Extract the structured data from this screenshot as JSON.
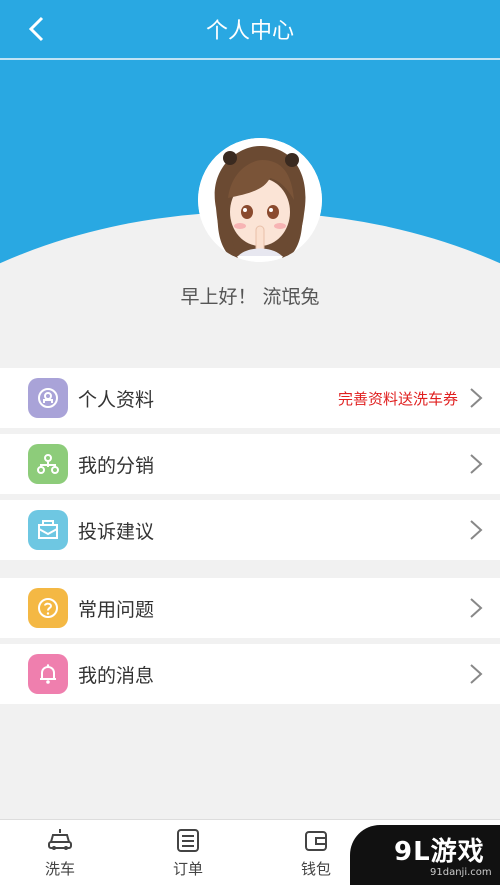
{
  "header": {
    "title": "个人中心"
  },
  "profile": {
    "greeting": "早上好！ 流氓兔"
  },
  "menu": {
    "group1": [
      {
        "label": "个人资料",
        "promo": "完善资料送洗车券",
        "icon": "user-icon",
        "color": "#a9a3d8"
      },
      {
        "label": "我的分销",
        "icon": "share-tree-icon",
        "color": "#8dcc7a"
      },
      {
        "label": "投诉建议",
        "icon": "envelope-icon",
        "color": "#6ec7e2"
      }
    ],
    "group2": [
      {
        "label": "常用问题",
        "icon": "question-icon",
        "color": "#f4b844"
      },
      {
        "label": "我的消息",
        "icon": "bell-icon",
        "color": "#ef7fae"
      }
    ]
  },
  "tabbar": [
    {
      "label": "洗车",
      "icon": "car-icon"
    },
    {
      "label": "订单",
      "icon": "list-icon"
    },
    {
      "label": "钱包",
      "icon": "wallet-icon"
    }
  ],
  "watermark": {
    "main": "9L游戏",
    "sub": "91danji.com"
  },
  "colors": {
    "primary": "#29a8e2",
    "promo": "#e02020",
    "background": "#f1f1f1"
  }
}
